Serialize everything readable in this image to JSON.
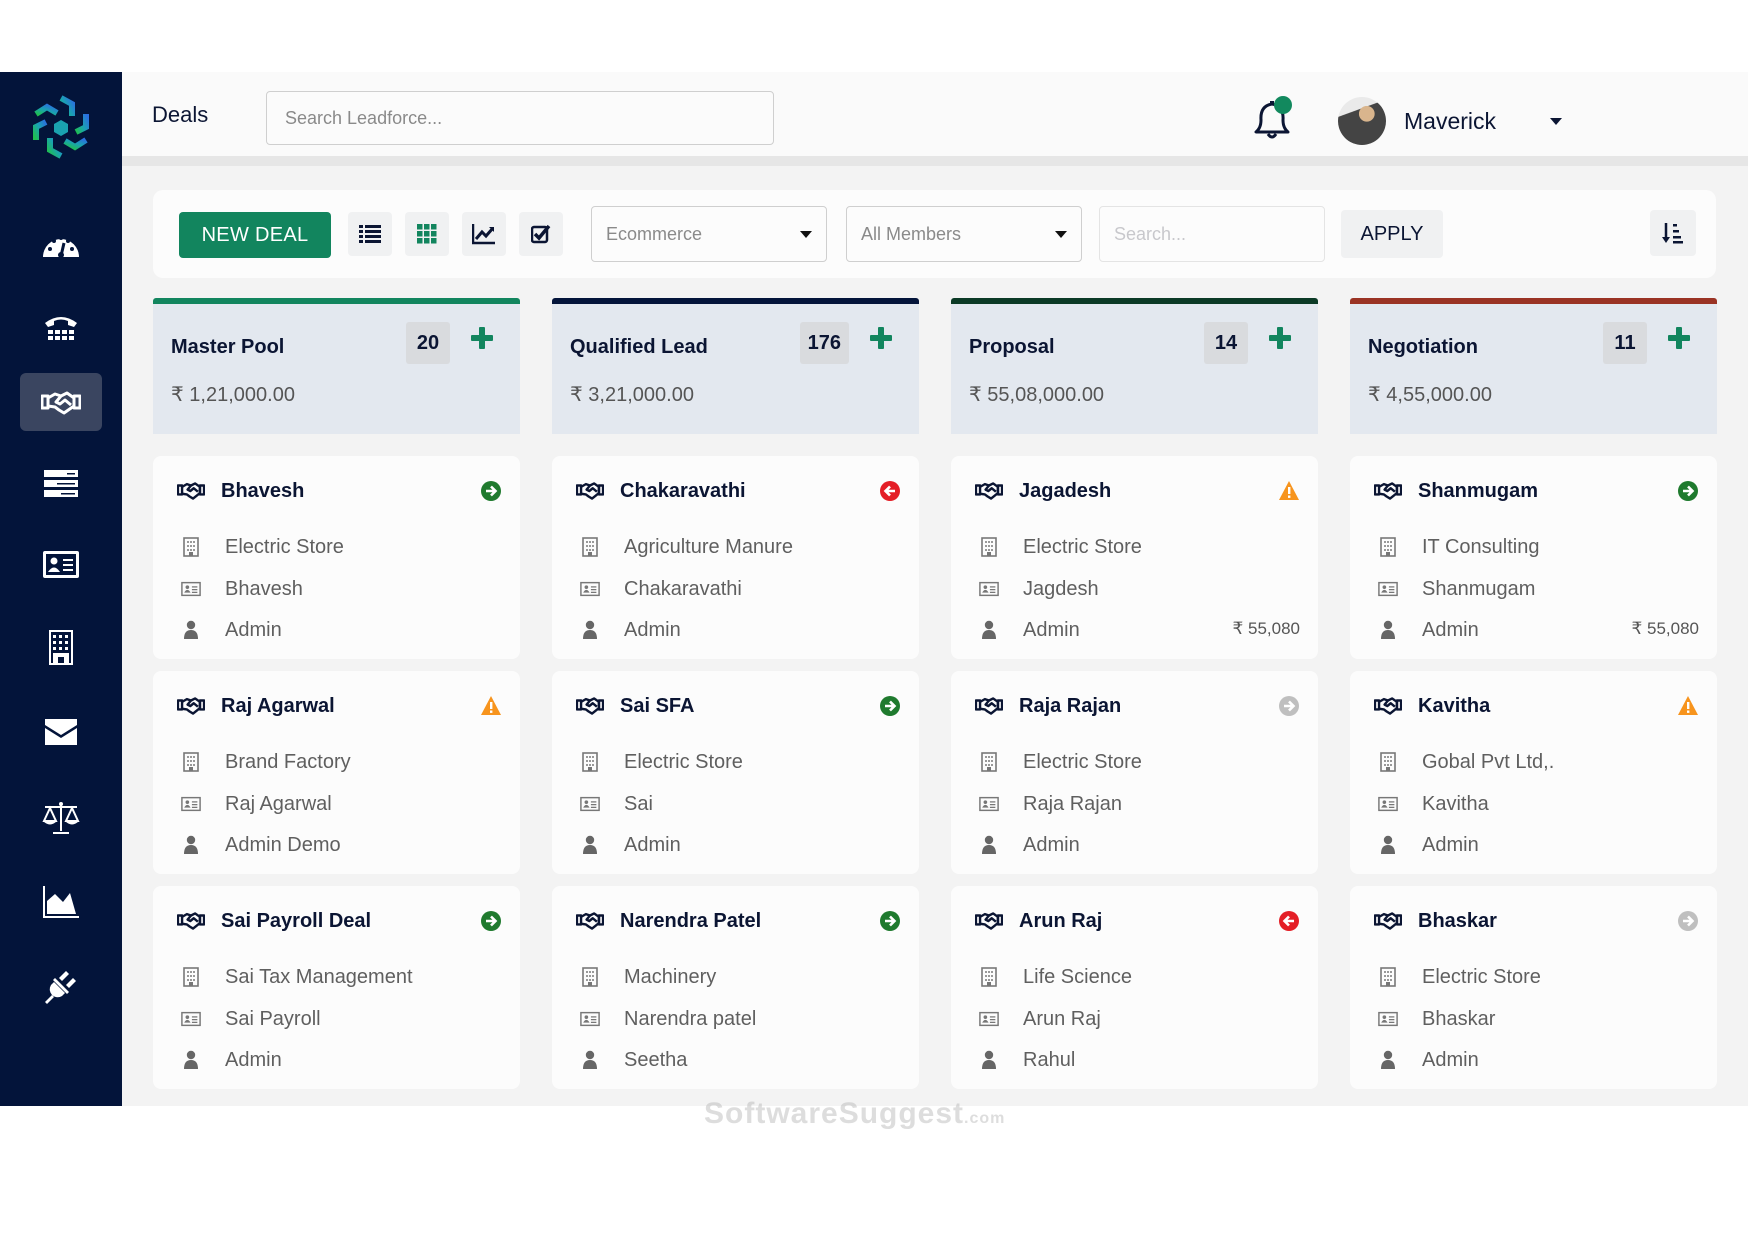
{
  "header": {
    "title": "Deals",
    "search_placeholder": "Search Leadforce...",
    "user_name": "Maverick",
    "notification_dot": true
  },
  "sidebar": {
    "items": [
      {
        "icon": "dashboard-icon",
        "label": "Dashboard",
        "active": false
      },
      {
        "icon": "phone-icon",
        "label": "Calls",
        "active": false
      },
      {
        "icon": "handshake-icon",
        "label": "Deals",
        "active": true
      },
      {
        "icon": "list-icon",
        "label": "Leads",
        "active": false
      },
      {
        "icon": "contact-card-icon",
        "label": "Contacts",
        "active": false
      },
      {
        "icon": "building-icon",
        "label": "Companies",
        "active": false
      },
      {
        "icon": "mail-icon",
        "label": "Mail",
        "active": false
      },
      {
        "icon": "scale-icon",
        "label": "Compare",
        "active": false
      },
      {
        "icon": "area-chart-icon",
        "label": "Reports",
        "active": false
      },
      {
        "icon": "plug-icon",
        "label": "Integrations",
        "active": false
      }
    ]
  },
  "toolbar": {
    "new_deal_label": "NEW DEAL",
    "view_buttons": [
      "list-view",
      "grid-view",
      "chart-view",
      "task-view"
    ],
    "pipeline_select": "Ecommerce",
    "members_select": "All Members",
    "search_placeholder": "Search...",
    "apply_label": "APPLY"
  },
  "colors": {
    "brand_green": "#12855e",
    "sidebar_bg": "#03143a",
    "status_forward": "#1f7a2e",
    "status_back": "#e41e26",
    "status_warning": "#f7941d",
    "status_neutral": "#bfbfbf"
  },
  "columns": [
    {
      "name": "Master Pool",
      "count": "20",
      "amount": "₹ 1,21,000.00",
      "accent": "#12855e",
      "deals": [
        {
          "title": "Bhavesh",
          "status": "forward",
          "company": "Electric Store",
          "contact": "Bhavesh",
          "owner": "Admin",
          "amount": ""
        },
        {
          "title": "Raj Agarwal",
          "status": "warning",
          "company": "Brand Factory",
          "contact": "Raj Agarwal",
          "owner": "Admin Demo",
          "amount": ""
        },
        {
          "title": "Sai Payroll Deal",
          "status": "forward",
          "company": "Sai Tax Management",
          "contact": "Sai Payroll",
          "owner": "Admin",
          "amount": ""
        }
      ]
    },
    {
      "name": "Qualified Lead",
      "count": "176",
      "amount": "₹ 3,21,000.00",
      "accent": "#03143a",
      "deals": [
        {
          "title": "Chakaravathi",
          "status": "back",
          "company": "Agriculture Manure",
          "contact": "Chakaravathi",
          "owner": "Admin",
          "amount": ""
        },
        {
          "title": "Sai SFA",
          "status": "forward",
          "company": "Electric Store",
          "contact": "Sai",
          "owner": "Admin",
          "amount": ""
        },
        {
          "title": "Narendra Patel",
          "status": "forward",
          "company": "Machinery",
          "contact": "Narendra patel",
          "owner": "Seetha",
          "amount": ""
        }
      ]
    },
    {
      "name": "Proposal",
      "count": "14",
      "amount": "₹ 55,08,000.00",
      "accent": "#0b3a26",
      "deals": [
        {
          "title": "Jagadesh",
          "status": "warning",
          "company": "Electric Store",
          "contact": "Jagdesh",
          "owner": "Admin",
          "amount": "₹ 55,080"
        },
        {
          "title": "Raja Rajan",
          "status": "neutral",
          "company": "Electric Store",
          "contact": "Raja Rajan",
          "owner": "Admin",
          "amount": ""
        },
        {
          "title": "Arun Raj",
          "status": "back",
          "company": "Life Science",
          "contact": "Arun Raj",
          "owner": "Rahul",
          "amount": ""
        }
      ]
    },
    {
      "name": "Negotiation",
      "count": "11",
      "amount": "₹ 4,55,000.00",
      "accent": "#9a3324",
      "deals": [
        {
          "title": "Shanmugam",
          "status": "forward",
          "company": "IT Consulting",
          "contact": "Shanmugam",
          "owner": "Admin",
          "amount": "₹ 55,080"
        },
        {
          "title": "Kavitha",
          "status": "warning",
          "company": "Gobal Pvt Ltd,.",
          "contact": "Kavitha",
          "owner": "Admin",
          "amount": ""
        },
        {
          "title": "Bhaskar",
          "status": "neutral",
          "company": "Electric Store",
          "contact": "Bhaskar",
          "owner": "Admin",
          "amount": ""
        }
      ]
    }
  ],
  "watermark": {
    "main": "SoftwareSuggest",
    "suffix": ".com"
  }
}
